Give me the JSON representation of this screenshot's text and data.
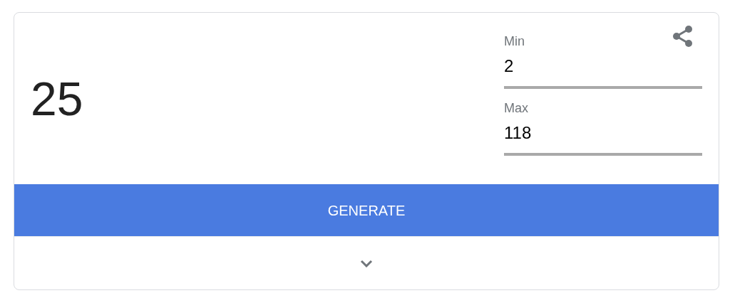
{
  "result": "25",
  "fields": [
    {
      "label": "Min",
      "value": "2"
    },
    {
      "label": "Max",
      "value": "118"
    }
  ],
  "button": "GENERATE"
}
